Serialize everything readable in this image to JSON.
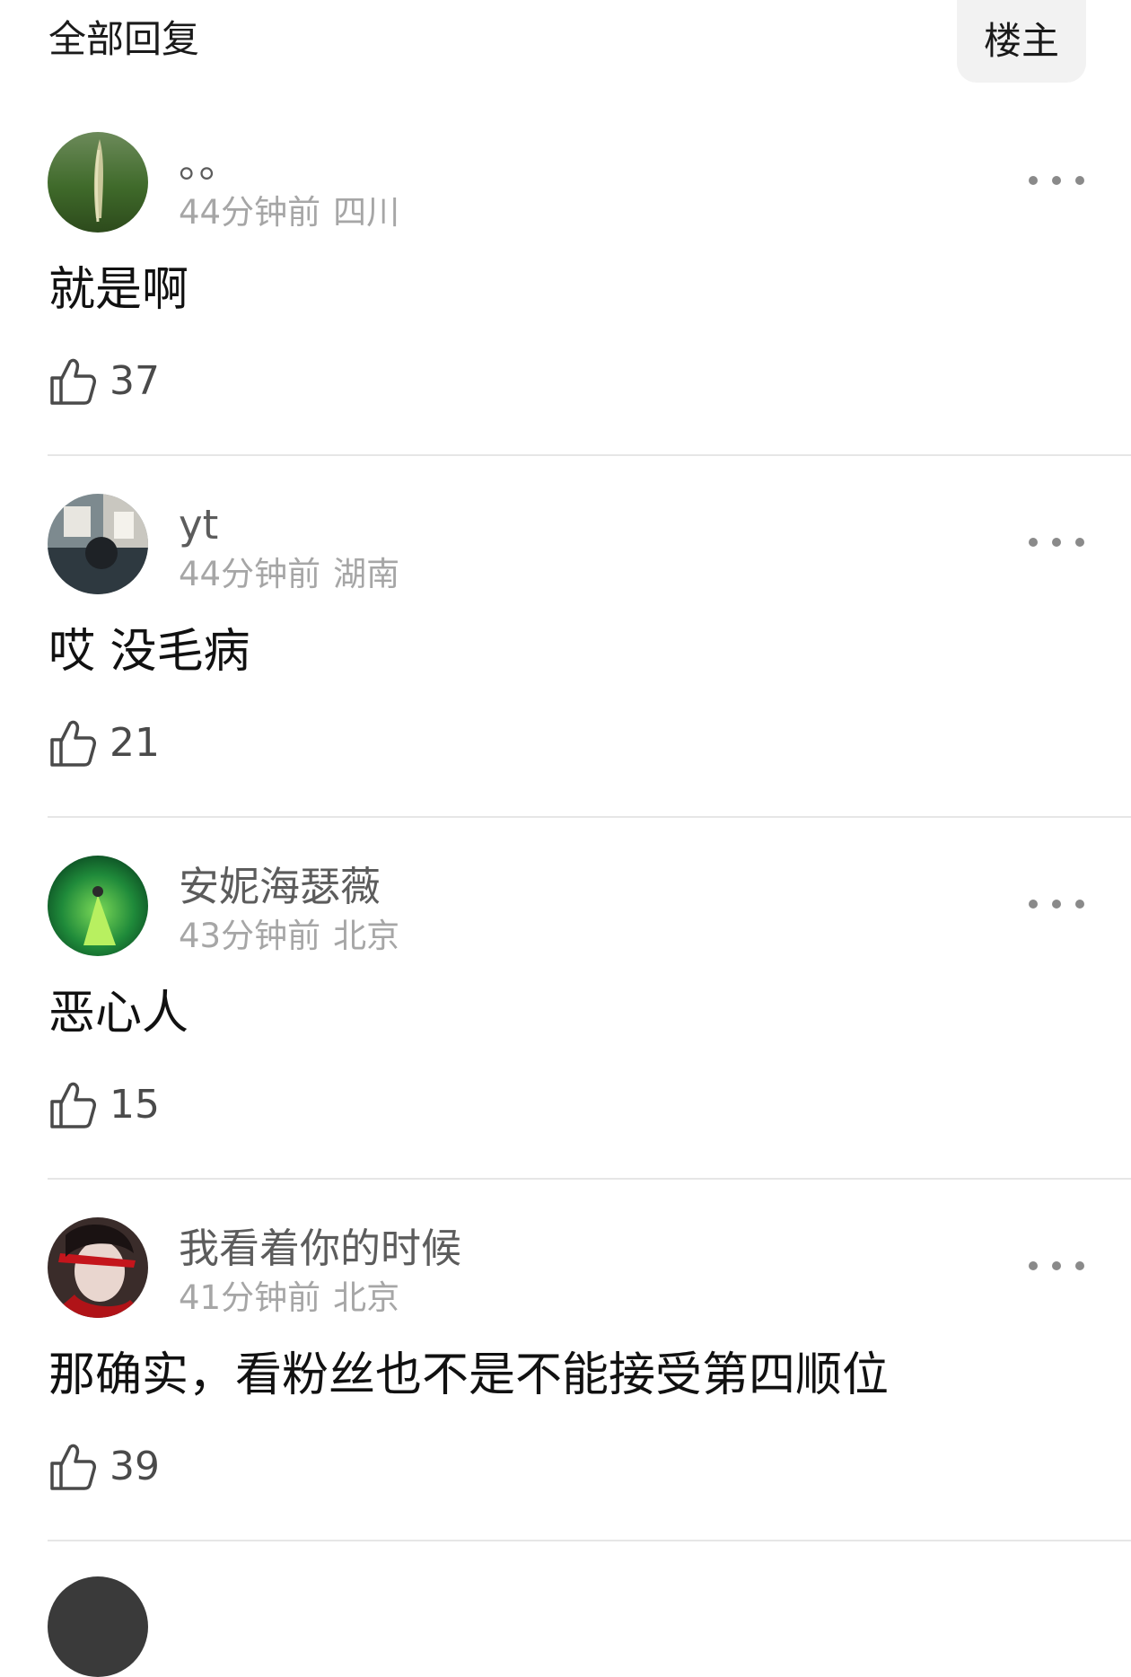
{
  "header": {
    "title": "全部回复",
    "op_filter_label": "楼主"
  },
  "comments": [
    {
      "username": "。。",
      "time": "44分钟前",
      "location": "四川",
      "text": "就是啊",
      "likes": "37"
    },
    {
      "username": "yt",
      "time": "44分钟前",
      "location": "湖南",
      "text": "哎 没毛病",
      "likes": "21"
    },
    {
      "username": "安妮海瑟薇",
      "time": "43分钟前",
      "location": "北京",
      "text": "恶心人",
      "likes": "15"
    },
    {
      "username": "我看着你的时候",
      "time": "41分钟前",
      "location": "北京",
      "text": "那确实，看粉丝也不是不能接受第四顺位",
      "likes": "39"
    }
  ],
  "icons": {
    "like": "thumbs-up-icon",
    "more": "more-horizontal-icon"
  },
  "colors": {
    "meta_text": "#a6a6a6",
    "username_text": "#5c5c5c",
    "divider": "#e6e6e6",
    "op_button_bg": "#f2f2f2"
  }
}
